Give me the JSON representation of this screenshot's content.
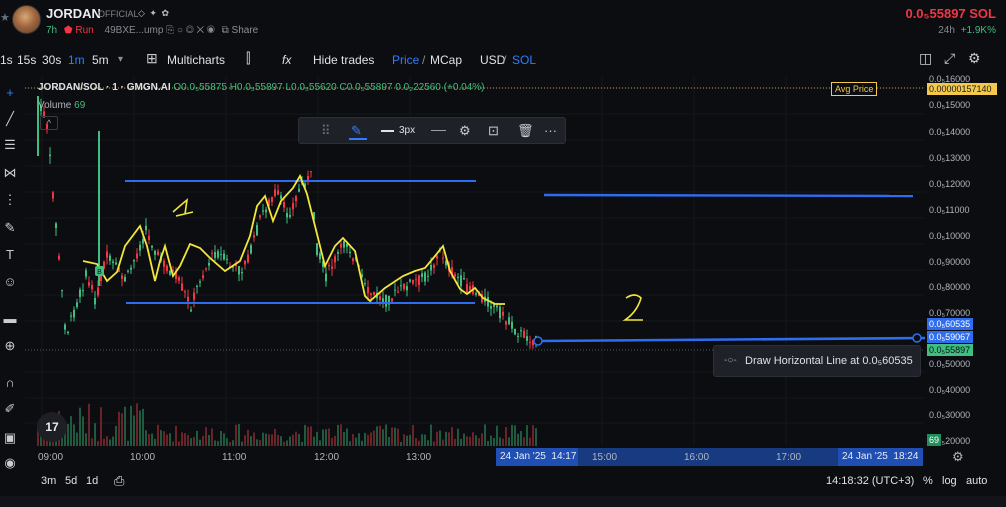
{
  "header": {
    "token_name": "JORDAN",
    "official_label": "OFFICIAL",
    "meta_icons": "◇ ✦ ✿",
    "age": "7h",
    "run_label": "Run",
    "address": "49BXE...ump",
    "link_icons": "⎘ ○ ◎ ✕ ◉",
    "share_label": "Share",
    "price": "0.0₅55897 SOL",
    "change_period": "24h",
    "change_pct": "+1.9K%"
  },
  "toolbar": {
    "intervals": [
      "1s",
      "15s",
      "30s",
      "1m",
      "5m"
    ],
    "active_interval": "1m",
    "dropdown_glyph": "▾",
    "multicharts_label": "Multicharts",
    "indicator_glyph": "fx",
    "hide_trades_label": "Hide trades",
    "price_label": "Price",
    "mcap_label": "MCap",
    "usd_label": "USD",
    "sol_label": "SOL",
    "slash": "/"
  },
  "legend": {
    "symbol": "JORDAN/SOL · 1 · GMGN.AI",
    "o": "O0.0₅55875",
    "h": "H0.0₅55897",
    "l": "L0.0₅55620",
    "c": "C0.0₅55897",
    "chg": "0.0₂22560 (+0.04%)",
    "volume_label": "Volume",
    "volume_value": "69",
    "collapse_glyph": "^"
  },
  "drawing_toolbar": {
    "width_label": "3px"
  },
  "avg_price_label": "Avg Price",
  "tooltip": {
    "text": "Draw Horizontal Line at 0.0₅60535"
  },
  "annotations": {
    "label_1": "1",
    "label_2": "2"
  },
  "price_axis": {
    "labels": [
      "0.0₅16000",
      "0.0₅15000",
      "0.0₅14000",
      "0.0₅13000",
      "0.0₅12000",
      "0.0₅11000",
      "0.0₅10000",
      "0.0₅90000",
      "0.0₅80000",
      "0.0₅70000",
      "0.0₅50000",
      "0.0₅40000",
      "0.0₅30000",
      "0.0₅20000"
    ],
    "avg_price_tag": "0.00000157140",
    "line_tag": "0.0₅60535",
    "current_tag": "0.0₅59067",
    "last_tag": "0.0₅55897",
    "volume_tag": "69"
  },
  "time_axis": {
    "labels": [
      "09:00",
      "10:00",
      "11:00",
      "12:00",
      "13:00",
      "15:00",
      "16:00",
      "17:00"
    ],
    "cursor_date": "24 Jan '25",
    "cursor_time": "14:17",
    "end_date": "24 Jan '25",
    "end_time": "18:24"
  },
  "bottom_bar": {
    "ranges": [
      "3m",
      "5d",
      "1d"
    ],
    "clock": "14:18:32 (UTC+3)",
    "percent_label": "%",
    "log_label": "log",
    "auto_label": "auto"
  },
  "tv_logo": "17",
  "colors": {
    "background": "#0c0d10",
    "accent_blue": "#2f7dff",
    "up_green": "#3fbf7f",
    "down_red": "#f23645",
    "annotation_yellow": "#f2e63a",
    "avg_yellow": "#f2c94c"
  }
}
